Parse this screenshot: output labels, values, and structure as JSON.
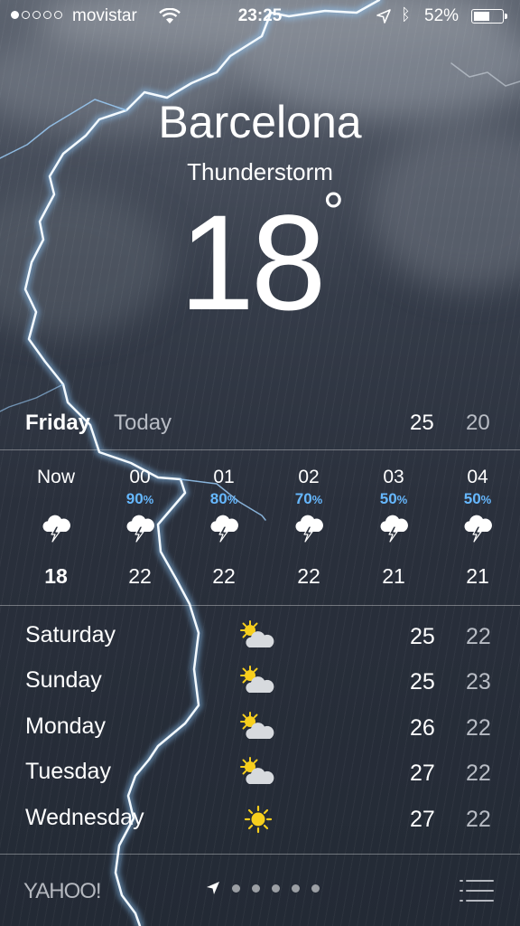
{
  "status_bar": {
    "carrier": "movistar",
    "time": "23:25",
    "battery_percent": "52%",
    "battery_level": 0.52,
    "signal_bars": 1,
    "signal_total": 5
  },
  "location": {
    "city": "Barcelona",
    "condition": "Thunderstorm",
    "temperature": "18",
    "degree_symbol": "°"
  },
  "today": {
    "day": "Friday",
    "label": "Today",
    "high": "25",
    "low": "20"
  },
  "hourly": [
    {
      "hour": "Now",
      "precip": "",
      "icon": "thunderstorm-icon",
      "temp": "18"
    },
    {
      "hour": "00",
      "precip": "90",
      "icon": "thunderstorm-icon",
      "temp": "22"
    },
    {
      "hour": "01",
      "precip": "80",
      "icon": "thunderstorm-icon",
      "temp": "22"
    },
    {
      "hour": "02",
      "precip": "70",
      "icon": "thunderstorm-icon",
      "temp": "22"
    },
    {
      "hour": "03",
      "precip": "50",
      "icon": "thunderstorm-icon",
      "temp": "21"
    },
    {
      "hour": "04",
      "precip": "50",
      "icon": "thunderstorm-icon",
      "temp": "21"
    }
  ],
  "percent_sign": "%",
  "daily": [
    {
      "day": "Saturday",
      "icon": "partly-sunny-icon",
      "high": "25",
      "low": "22"
    },
    {
      "day": "Sunday",
      "icon": "partly-sunny-icon",
      "high": "25",
      "low": "23"
    },
    {
      "day": "Monday",
      "icon": "partly-sunny-icon",
      "high": "26",
      "low": "22"
    },
    {
      "day": "Tuesday",
      "icon": "partly-sunny-icon",
      "high": "27",
      "low": "22"
    },
    {
      "day": "Wednesday",
      "icon": "sun-icon",
      "high": "27",
      "low": "22"
    }
  ],
  "footer": {
    "brand": "YAHOO!",
    "page_dots": 5,
    "current_page": "current-location"
  },
  "colors": {
    "precip_blue": "#66b8ff",
    "sun_yellow": "#f7cf1d",
    "low_temp_gray": "#b8bcc4"
  }
}
